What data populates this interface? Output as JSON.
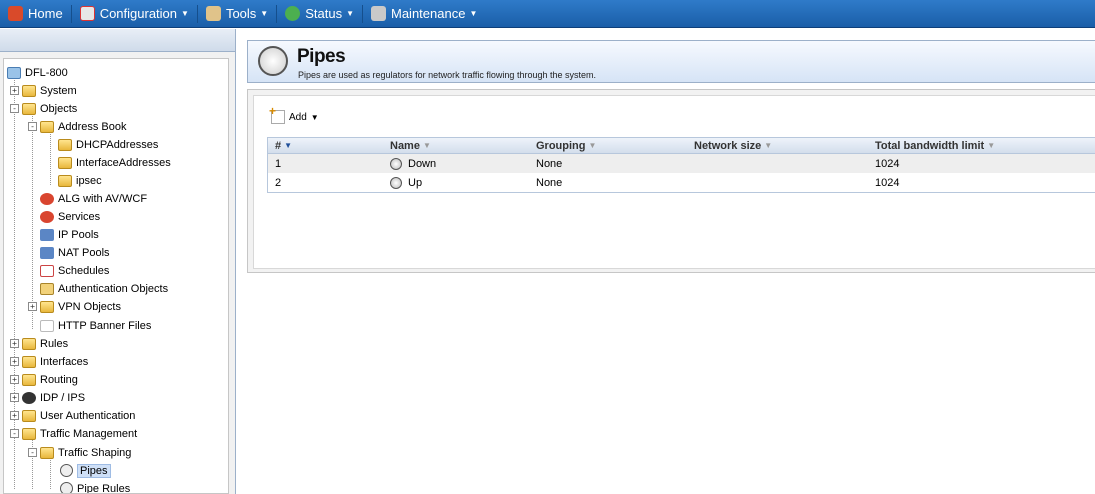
{
  "nav": {
    "home": "Home",
    "configuration": "Configuration",
    "tools": "Tools",
    "status": "Status",
    "maintenance": "Maintenance"
  },
  "tree": {
    "root": "DFL-800",
    "system": "System",
    "objects": "Objects",
    "address_book": "Address Book",
    "dhcp_addresses": "DHCPAddresses",
    "interface_addresses": "InterfaceAddresses",
    "ipsec": "ipsec",
    "alg": "ALG with AV/WCF",
    "services": "Services",
    "ip_pools": "IP Pools",
    "nat_pools": "NAT Pools",
    "schedules": "Schedules",
    "auth_objects": "Authentication Objects",
    "vpn_objects": "VPN Objects",
    "http_banner": "HTTP Banner Files",
    "rules": "Rules",
    "interfaces": "Interfaces",
    "routing": "Routing",
    "idp_ips": "IDP / IPS",
    "user_auth": "User Authentication",
    "traffic_mgmt": "Traffic Management",
    "traffic_shaping": "Traffic Shaping",
    "pipes": "Pipes",
    "pipe_rules": "Pipe Rules"
  },
  "page": {
    "title": "Pipes",
    "description": "Pipes are used as regulators for network traffic flowing through the system.",
    "add_label": "Add"
  },
  "grid": {
    "columns": [
      "#",
      "Name",
      "Grouping",
      "Network size",
      "Total bandwidth limit"
    ],
    "rows": [
      {
        "num": "1",
        "name": "Down",
        "grouping": "None",
        "network_size": "",
        "bandwidth": "1024"
      },
      {
        "num": "2",
        "name": "Up",
        "grouping": "None",
        "network_size": "",
        "bandwidth": "1024"
      }
    ]
  },
  "colors": {
    "nav_bg": "#1a5ea8",
    "header_bg": "#d6e4f6",
    "selected": "#cfe0f7"
  }
}
